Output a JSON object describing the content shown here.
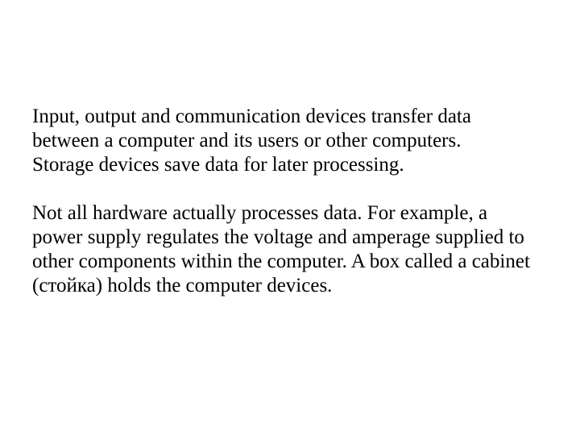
{
  "content": {
    "paragraph1_line1": "Input, output and communication devices transfer data between a computer and its users or other computers.",
    "paragraph1_line2": "Storage devices save data for later processing.",
    "paragraph2": "Not all hardware actually processes data. For example, a power supply regulates the voltage and amperage supplied to other components within the computer. A box called a cabinet (стойка) holds the computer devices."
  }
}
